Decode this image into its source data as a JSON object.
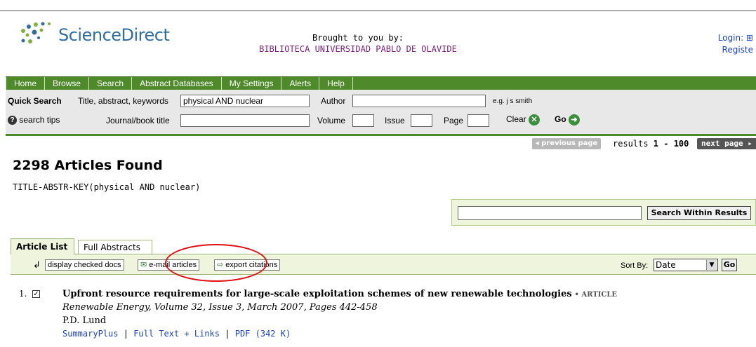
{
  "header": {
    "logo_text": "ScienceDirect",
    "brought_label": "Brought to you by:",
    "institution": "BIBLIOTECA UNIVERSIDAD PABLO DE OLAVIDE",
    "login": "Login: ⊞",
    "register": "Registe"
  },
  "nav": {
    "items": [
      "Home",
      "Browse",
      "Search",
      "Abstract Databases",
      "My Settings",
      "Alerts",
      "Help"
    ]
  },
  "quick_search": {
    "label": "Quick Search",
    "title_label": "Title, abstract, keywords",
    "title_value": "physical AND nuclear",
    "author_label": "Author",
    "author_value": "",
    "example": "e.g. j s smith",
    "search_tips": "search tips",
    "journal_label": "Journal/book title",
    "journal_value": "",
    "volume_label": "Volume",
    "issue_label": "Issue",
    "page_label": "Page",
    "clear_label": "Clear",
    "go_label": "Go"
  },
  "pager": {
    "prev": "◂ previous page",
    "results_prefix": "results ",
    "results_range": "1 - 100",
    "next": "next page ▸"
  },
  "results_header": {
    "found": "2298 Articles Found",
    "query": "TITLE-ABSTR-KEY(physical AND nuclear)"
  },
  "search_within": {
    "value": "",
    "button": "Search Within Results"
  },
  "tabs": {
    "article_list": "Article List",
    "full_abstracts": "Full Abstracts"
  },
  "toolbar": {
    "arrow": "↲",
    "display_checked": "display checked docs",
    "email": "e-mail articles",
    "export": "export citations",
    "sort_by_label": "Sort By:",
    "sort_value": "Date",
    "go": "Go"
  },
  "results": [
    {
      "num": "1.",
      "checked": "✓",
      "title": "Upfront resource requirements for large-scale exploitation schemes of new renewable technologies",
      "type": "• ARTICLE",
      "source": "Renewable Energy, Volume 32, Issue 3, March 2007, Pages 442-458",
      "authors": "P.D. Lund",
      "links": [
        "SummaryPlus",
        "Full Text + Links",
        "PDF (342 K)"
      ]
    }
  ]
}
